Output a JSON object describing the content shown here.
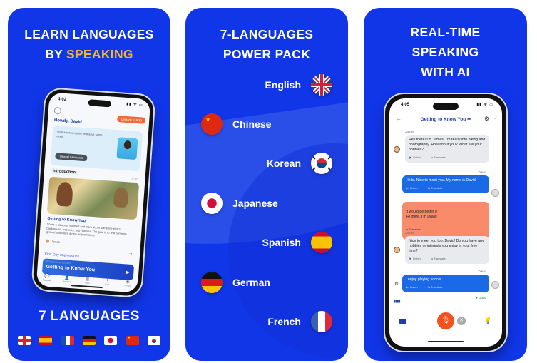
{
  "card1": {
    "headline_line1": "LEARN LANGUAGES",
    "headline_by": "BY ",
    "headline_accent": "SPEAKING",
    "phone": {
      "time": "4:02",
      "signal": "▮▮ ᯤ ▭",
      "upgrade_label": "Upgrade to PRO",
      "greeting": "Howdy, David",
      "prompt": "Start a conversation and save some word",
      "view_button": "View all flashcards",
      "section": "Introduction",
      "progress": "0 / 15",
      "lesson_title": "Getting to Know You",
      "lesson_desc": "Share a bit about yourself and learn about someone else's background, interests, and hobbies. The goal is to find common ground and make a new acquaintance.",
      "author": "James",
      "next_section": "First Day Impressions",
      "banner_small": "Full speaking session",
      "banner_title": "Getting to Know You",
      "nav": [
        {
          "icon": "chat-icon",
          "glyph": "💬",
          "label": "Practice",
          "active": true
        },
        {
          "icon": "person-icon",
          "glyph": "👤",
          "label": "Speaking",
          "active": false
        },
        {
          "icon": "stats-icon",
          "glyph": "▥",
          "label": "Stats",
          "active": false
        },
        {
          "icon": "magic-icon",
          "glyph": "✦",
          "label": "Tools",
          "active": false
        },
        {
          "icon": "profile-icon",
          "glyph": "◉",
          "label": "Profile",
          "active": false
        }
      ]
    },
    "footer": "7 LANGUAGES",
    "flags": [
      "england",
      "spain",
      "france",
      "germany",
      "japan",
      "china",
      "korea"
    ]
  },
  "card2": {
    "headline_line1": "7-LANGUAGES",
    "headline_line2": "POWER PACK",
    "languages": [
      {
        "name": "English",
        "flag": "uk",
        "side": "right"
      },
      {
        "name": "Chinese",
        "flag": "china",
        "side": "left"
      },
      {
        "name": "Korean",
        "flag": "korea",
        "side": "right"
      },
      {
        "name": "Japanese",
        "flag": "japan",
        "side": "left"
      },
      {
        "name": "Spanish",
        "flag": "spain",
        "side": "right"
      },
      {
        "name": "German",
        "flag": "germany",
        "side": "left"
      },
      {
        "name": "French",
        "flag": "france",
        "side": "right"
      }
    ]
  },
  "card3": {
    "headline_line1": "REAL-TIME",
    "headline_line2": "SPEAKING",
    "headline_line3": "WITH AI",
    "phone": {
      "time": "4:05",
      "signal": "▮▮ ᯤ ▭",
      "chat_title": "Getting to Know You ➦",
      "listen_label": "Listen",
      "translate_label": "Translate",
      "messages": [
        {
          "speaker": "James",
          "role": "ai",
          "text": "Hey there! I'm James. I'm really into hiking and photography. How about you? What are your hobbies?"
        },
        {
          "speaker": "David",
          "role": "me",
          "text": "Hello. Nice to meet you. My name is David."
        },
        {
          "speaker": "",
          "role": "fix",
          "text": "It would be better if\n'Hi there. I'm David'"
        },
        {
          "speaker": "James",
          "role": "ai",
          "text": "Nice to meet you too, David! Do you have any hobbies or interests you enjoy in your free time?"
        },
        {
          "speaker": "David",
          "role": "me",
          "text": "I enjoy playing soccer."
        }
      ],
      "feedback": "Good",
      "mic_glyph": "🎙"
    }
  }
}
